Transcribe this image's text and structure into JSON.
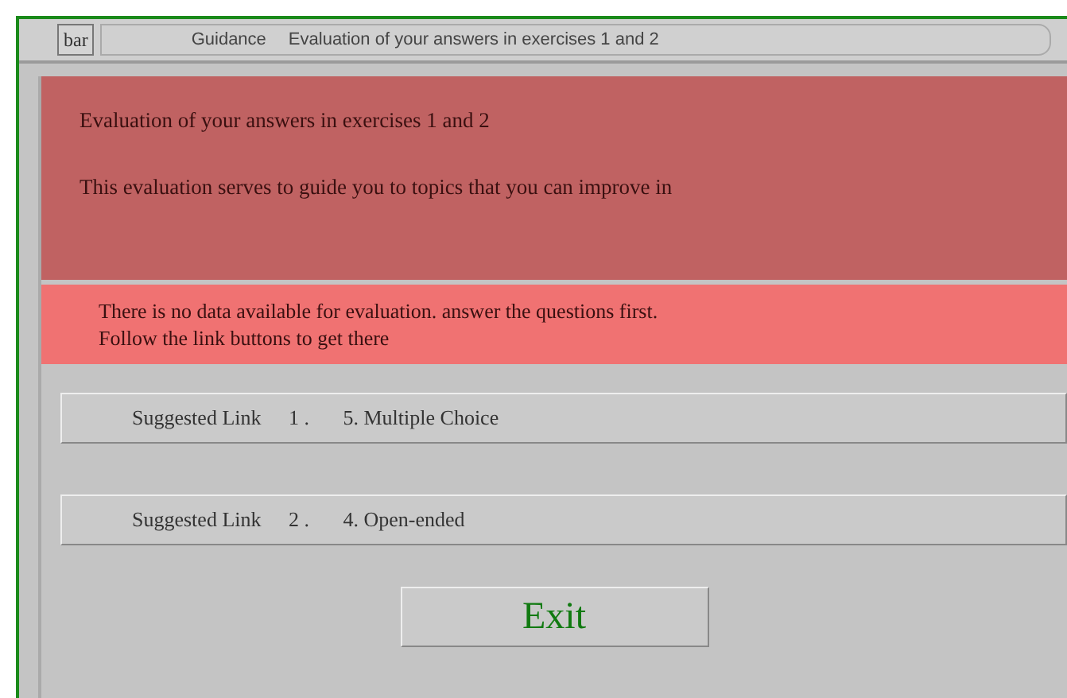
{
  "title_bar": {
    "button": "bar",
    "section": "Guidance",
    "title": "Evaluation of your answers in exercises 1 and 2"
  },
  "intro": {
    "heading": "Evaluation of your answers in exercises 1 and 2",
    "text": "This evaluation serves to guide you to topics that you can improve in"
  },
  "notice": {
    "lines": [
      "There is no data available for evaluation. answer the questions first.",
      "Follow the link buttons to get there"
    ]
  },
  "links": [
    {
      "label": "Suggested Link",
      "number": "1 .",
      "target": "5. Multiple Choice"
    },
    {
      "label": "Suggested Link",
      "number": "2 .",
      "target": "4. Open-ended"
    }
  ],
  "exit_button": "Exit"
}
